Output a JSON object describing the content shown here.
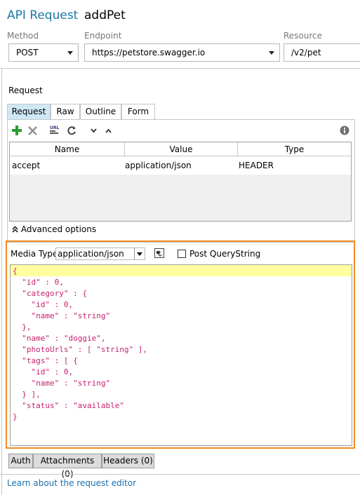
{
  "header": {
    "title": "API Request",
    "name": "addPet"
  },
  "fields": {
    "method": {
      "label": "Method",
      "value": "POST"
    },
    "endpoint": {
      "label": "Endpoint",
      "value": "https://petstore.swagger.io"
    },
    "resource": {
      "label": "Resource",
      "value": "/v2/pet"
    }
  },
  "request": {
    "section_label": "Request",
    "tabs": [
      "Request",
      "Raw",
      "Outline",
      "Form"
    ],
    "active_tab": "Request",
    "toolbar_icons": [
      "add-icon",
      "delete-icon",
      "url-encode-icon",
      "refresh-icon",
      "move-down-icon",
      "move-up-icon",
      "info-icon"
    ],
    "table": {
      "columns": [
        "Name",
        "Value",
        "Type"
      ],
      "rows": [
        {
          "name": "accept",
          "value": "application/json",
          "type": "HEADER"
        }
      ]
    },
    "advanced_options": "Advanced options"
  },
  "media": {
    "label": "Media Type",
    "value": "application/json",
    "post_querystring_label": "Post QueryString",
    "post_querystring_checked": false
  },
  "body_lines": [
    "{",
    "  \"id\" : 0,",
    "  \"category\" : {",
    "    \"id\" : 0,",
    "    \"name\" : \"string\"",
    "  },",
    "  \"name\" : \"doggie\",",
    "  \"photoUrls\" : [ \"string\" ],",
    "  \"tags\" : [ {",
    "    \"id\" : 0,",
    "    \"name\" : \"string\"",
    "  } ],",
    "  \"status\" : \"available\"",
    "}"
  ],
  "bottom_tabs": [
    "Auth",
    "Attachments (0)",
    "Headers (0)"
  ],
  "footer_link": "Learn about the request editor",
  "colors": {
    "accent": "#1b7aa6",
    "highlight_border": "#f08a24",
    "code_text": "#c51f70",
    "current_line": "#ffffa0"
  }
}
